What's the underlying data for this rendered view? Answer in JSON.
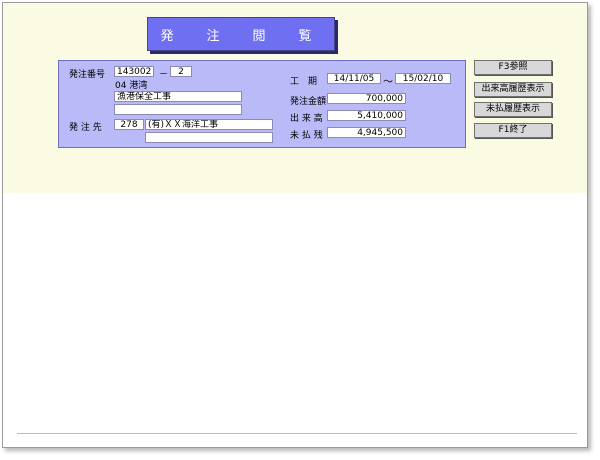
{
  "title": "発　注　閲　覧",
  "form": {
    "order_no_label": "発注番号",
    "order_no": "143002",
    "order_no_sep": "－",
    "order_branch": "2",
    "area_code_name": "04 港湾",
    "project_name": "漁港保全工事",
    "project_extra": "",
    "vendor_label": "発 注 先",
    "vendor_code": "278",
    "vendor_name": "(有)ＸＸ海洋工事",
    "vendor_extra": "",
    "period_label": "工　期",
    "period_start": "14/11/05",
    "period_sep": "～",
    "period_end": "15/02/10",
    "amount_label": "発注金額",
    "amount": "700,000",
    "progress_label": "出 来 高",
    "progress": "5,410,000",
    "unpaid_label": "未 払 残",
    "unpaid": "4,945,500"
  },
  "buttons": {
    "ref": "F3参照",
    "progress_history": "出来高履歴表示",
    "unpaid_history": "未払履歴表示",
    "exit": "F1終了"
  }
}
